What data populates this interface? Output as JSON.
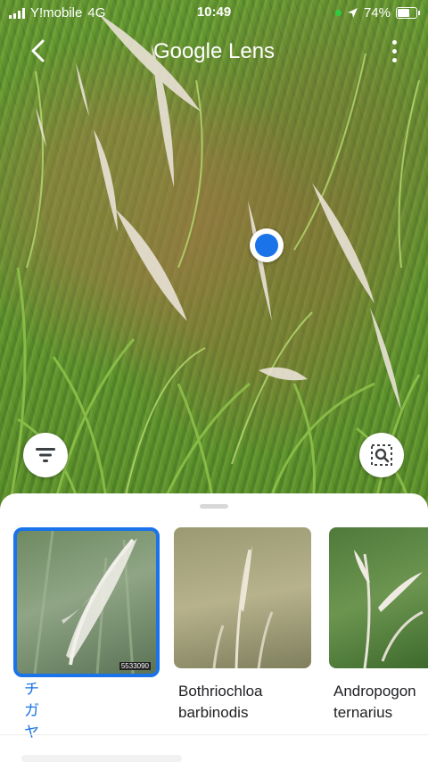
{
  "status_bar": {
    "carrier": "Y!mobile",
    "network": "4G",
    "time": "10:49",
    "battery": "74%",
    "battery_level": 0.74
  },
  "header": {
    "title": "Google Lens"
  },
  "icons": {
    "back": "back-arrow-icon",
    "more": "more-vert-icon",
    "filter": "filter-icon",
    "scan": "search-region-icon",
    "location": "location-arrow-icon"
  },
  "results": [
    {
      "label": "チガヤ",
      "selected": true,
      "thumb_caption": "5533090"
    },
    {
      "label": "Bothriochloa\nbarbinodis",
      "selected": false
    },
    {
      "label": "Andropogon\nternarius",
      "selected": false
    }
  ],
  "colors": {
    "accent": "#1a73e8",
    "selected_label": "#1a73e8"
  }
}
